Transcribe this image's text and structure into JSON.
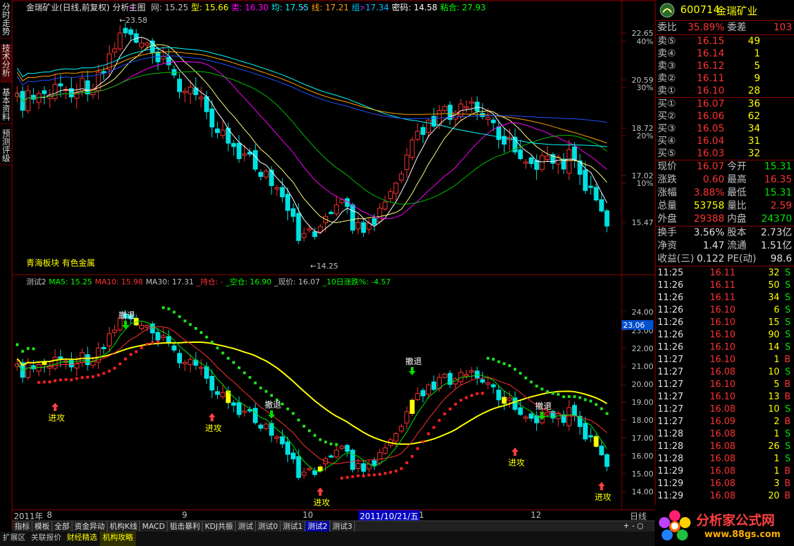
{
  "left_tabs": [
    "分时走势",
    "技术分析",
    "基本资料",
    "预测评级"
  ],
  "header": {
    "stock_name": "金瑞矿业",
    "mode": "(日线,前复权)",
    "title": "分析主图",
    "items": [
      {
        "label": "网: 15.25",
        "color": "#c0c0c0"
      },
      {
        "label": "型: 15.66",
        "color": "#ffff00"
      },
      {
        "label": "类: 16.30",
        "color": "#ff00ff"
      },
      {
        "label": "均: 17.55",
        "color": "#00ffff"
      },
      {
        "label": "线: 17.21",
        "color": "#ffa000"
      },
      {
        "label": "组: 17.34",
        "color": "#00c0ff"
      },
      {
        "label": "密码: 14.58",
        "color": "#ffffff"
      },
      {
        "label": "粘合: 27.93",
        "color": "#00ff00"
      }
    ]
  },
  "main_axis": {
    "labels": [
      "22.65",
      "40%",
      "20.59",
      "30%",
      "18.72",
      "20%",
      "17.02",
      "10%",
      "15.47"
    ]
  },
  "price_marks": {
    "high": "23.58",
    "low": "14.25"
  },
  "sector_text": "青海板块  有色金属",
  "sub_header": {
    "items": [
      {
        "label": "测试2",
        "color": "#c0c0c0"
      },
      {
        "label": "MA5: 15.25",
        "color": "#00ff00"
      },
      {
        "label": "MA10: 15.98",
        "color": "#ff3232"
      },
      {
        "label": "MA30: 17.31",
        "color": "#c0c0c0"
      },
      {
        "label": "_持仓: -",
        "color": "#ff3232"
      },
      {
        "label": "_空仓: 16.90",
        "color": "#00ff00"
      },
      {
        "label": "_现价: 16.07",
        "color": "#c0c0c0"
      },
      {
        "label": "_10日涨跌%: -4.57",
        "color": "#00ff00"
      }
    ]
  },
  "sub_axis": {
    "labels": [
      "24.00",
      "23.00",
      "22.00",
      "21.00",
      "20.00",
      "19.00",
      "18.00",
      "17.00",
      "16.00",
      "15.00",
      "14.00"
    ],
    "current": "23.06"
  },
  "signals": {
    "attack": "进攻",
    "retreat": "撤退"
  },
  "x_axis": {
    "labels": [
      "2011年",
      "8",
      "9",
      "10",
      "11",
      "12"
    ],
    "cursor": "2011/10/21/五",
    "period": "日线"
  },
  "indicator_tabs": [
    "指标",
    "模板",
    "全部",
    "资金异动",
    "机构K线",
    "MACD",
    "狙击暴利",
    "KDJ共振",
    "测试",
    "测试0",
    "测试1",
    "测试2",
    "测试3"
  ],
  "active_tab": "测试2",
  "bottom_tabs": [
    "扩展区",
    "关联报价",
    "财经精选",
    "机构攻略"
  ],
  "quote": {
    "code": "600714",
    "name": "金瑞矿业",
    "weibi_label": "委比",
    "weibi": "35.89%",
    "weicha_label": "委差",
    "weicha": "103",
    "sells": [
      {
        "label": "卖⑤",
        "price": "16.15",
        "vol": "49"
      },
      {
        "label": "卖④",
        "price": "16.14",
        "vol": "1"
      },
      {
        "label": "卖③",
        "price": "16.12",
        "vol": "5"
      },
      {
        "label": "卖②",
        "price": "16.11",
        "vol": "9"
      },
      {
        "label": "卖①",
        "price": "16.10",
        "vol": "28"
      }
    ],
    "buys": [
      {
        "label": "买①",
        "price": "16.07",
        "vol": "36"
      },
      {
        "label": "买②",
        "price": "16.06",
        "vol": "62"
      },
      {
        "label": "买③",
        "price": "16.05",
        "vol": "34"
      },
      {
        "label": "买④",
        "price": "16.04",
        "vol": "31"
      },
      {
        "label": "买⑤",
        "price": "16.03",
        "vol": "32"
      }
    ],
    "stats": [
      {
        "l1": "现价",
        "v1": "16.07",
        "c1": "#ff3232",
        "l2": "今开",
        "v2": "15.31",
        "c2": "#00e600"
      },
      {
        "l1": "涨跌",
        "v1": "0.60",
        "c1": "#ff3232",
        "l2": "最高",
        "v2": "16.35",
        "c2": "#ff3232"
      },
      {
        "l1": "涨幅",
        "v1": "3.88%",
        "c1": "#ff3232",
        "l2": "最低",
        "v2": "15.31",
        "c2": "#00e600"
      },
      {
        "l1": "总量",
        "v1": "53758",
        "c1": "#ffff00",
        "l2": "量比",
        "v2": "2.59",
        "c2": "#ff3232"
      },
      {
        "l1": "外盘",
        "v1": "29388",
        "c1": "#ff3232",
        "l2": "内盘",
        "v2": "24370",
        "c2": "#00e600"
      }
    ],
    "stats2": [
      {
        "l1": "换手",
        "v1": "3.56%",
        "l2": "股本",
        "v2": "2.73亿"
      },
      {
        "l1": "净资",
        "v1": "1.47",
        "l2": "流通",
        "v2": "1.51亿"
      },
      {
        "l1": "收益(三)",
        "v1": "0.122",
        "l2": "PE(动)",
        "v2": "98.6"
      }
    ],
    "ticks": [
      {
        "t": "11:25",
        "p": "16.11",
        "v": "32",
        "s": "S"
      },
      {
        "t": "11:26",
        "p": "16.11",
        "v": "50",
        "s": "S"
      },
      {
        "t": "11:26",
        "p": "16.11",
        "v": "34",
        "s": "S"
      },
      {
        "t": "11:26",
        "p": "16.10",
        "v": "6",
        "s": "S"
      },
      {
        "t": "11:26",
        "p": "16.10",
        "v": "15",
        "s": "S"
      },
      {
        "t": "11:26",
        "p": "16.10",
        "v": "90",
        "s": "S"
      },
      {
        "t": "11:26",
        "p": "16.10",
        "v": "14",
        "s": "S"
      },
      {
        "t": "11:27",
        "p": "16.10",
        "v": "1",
        "s": "B"
      },
      {
        "t": "11:27",
        "p": "16.08",
        "v": "10",
        "s": "S"
      },
      {
        "t": "11:27",
        "p": "16.10",
        "v": "5",
        "s": "B"
      },
      {
        "t": "11:27",
        "p": "16.10",
        "v": "13",
        "s": "B"
      },
      {
        "t": "11:27",
        "p": "16.08",
        "v": "10",
        "s": "S"
      },
      {
        "t": "11:27",
        "p": "16.09",
        "v": "2",
        "s": "B"
      },
      {
        "t": "11:28",
        "p": "16.08",
        "v": "1",
        "s": "S"
      },
      {
        "t": "11:28",
        "p": "16.08",
        "v": "26",
        "s": "S"
      },
      {
        "t": "11:28",
        "p": "16.08",
        "v": "1",
        "s": "S"
      },
      {
        "t": "11:29",
        "p": "16.08",
        "v": "1",
        "s": "B"
      },
      {
        "t": "11:29",
        "p": "16.08",
        "v": "3",
        "s": "B"
      },
      {
        "t": "11:29",
        "p": "16.08",
        "v": "20",
        "s": "B"
      }
    ]
  },
  "watermark": {
    "title": "分析家公式网",
    "url": "www.88gs.com"
  }
}
